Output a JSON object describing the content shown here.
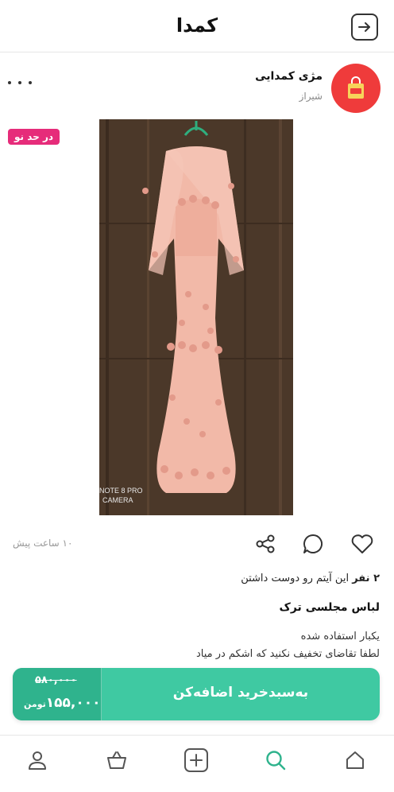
{
  "header": {
    "logo": "کمدا"
  },
  "seller": {
    "name": "مژی کمدایی",
    "city": "شیراز"
  },
  "badge": "در حد نو",
  "post": {
    "time_ago": "۱۰ ساعت پیش"
  },
  "likes": {
    "count": "۲ نفر",
    "text": " این آیتم رو دوست داشتن"
  },
  "item": {
    "title": "لباس مجلسی ترک",
    "desc_line1": "یکبار استفاده شده",
    "desc_line2": "لطفا تقاضای تخفیف نکنید که اشکم در میاد"
  },
  "photo_watermark": {
    "line1": "NOTE 8 PRO",
    "line2": "CAMERA"
  },
  "cart": {
    "old_price": "۵۸۰,۰۰۰",
    "new_price": "۱۵۵,۰۰۰",
    "currency": "تومن",
    "label": "به‌سبدخرید اضافه‌کن"
  },
  "colors": {
    "accent": "#3fc9a2",
    "badge": "#e62c7a",
    "avatar": "#ef3b3b"
  }
}
